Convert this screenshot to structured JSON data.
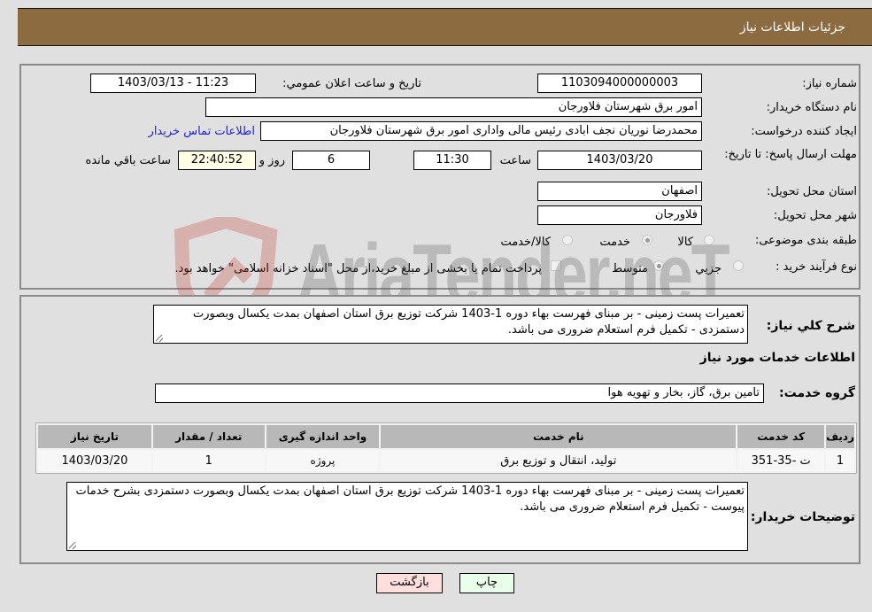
{
  "header": {
    "title": "جزئیات اطلاعات نیاز"
  },
  "form": {
    "need_number": {
      "label": "شماره نیاز:",
      "value": "1103094000000003"
    },
    "announce_datetime": {
      "label": "تاریخ و ساعت اعلان عمومي:",
      "value": "1403/03/13 - 11:23"
    },
    "buyer_org": {
      "label": "نام دستگاه خریدار:",
      "value": "امور برق شهرستان فلاورجان"
    },
    "requester": {
      "label": "ایجاد کننده درخواست:",
      "value": "محمدرضا نوریان نجف ابادی رئیس مالی واداری  امور برق شهرستان فلاورجان"
    },
    "buyer_contact_link": "اطلاعات تماس خریدار",
    "deadline": {
      "label": "مهلت ارسال پاسخ: تا تاریخ:",
      "date": "1403/03/20",
      "time_label": "ساعت",
      "time": "11:30",
      "days": "6",
      "days_label": "روز و",
      "remaining": "22:40:52",
      "remaining_label": "ساعت باقي مانده"
    },
    "province": {
      "label": "استان محل تحویل:",
      "value": "اصفهان"
    },
    "city": {
      "label": "شهر محل تحویل:",
      "value": "فلاورجان"
    },
    "category": {
      "label": "طبقه بندی موضوعی:",
      "options": [
        {
          "label": "کالا",
          "selected": false
        },
        {
          "label": "خدمت",
          "selected": true
        },
        {
          "label": "کالا/خدمت",
          "selected": false
        }
      ]
    },
    "purchase_type": {
      "label": "نوع فرآیند خرید :",
      "options": [
        {
          "label": "جزيي",
          "selected": false
        },
        {
          "label": "متوسط",
          "selected": true
        }
      ],
      "treasury_note": "پرداخت تمام یا بخشی از مبلغ خرید،از محل \"اسناد خزانه اسلامی\" خواهد بود.",
      "treasury_checked": false
    }
  },
  "description": {
    "label": "شرح كلي نياز:",
    "value": "تعمیرات پست زمینی  - بر مبنای فهرست بهاء دوره 1-1403 شرکت توزیع برق استان اصفهان بمدت یکسال وبصورت دستمزدی - تکمیل فرم استعلام ضروری می باشد."
  },
  "services": {
    "section_title": "اطلاعات خدمات مورد نیاز",
    "group_label": "گروه خدمت:",
    "group_value": "تامین برق، گاز، بخار و تهویه هوا",
    "table": {
      "headers": [
        "ردیف",
        "کد خدمت",
        "نام خدمت",
        "واحد اندازه گیری",
        "تعداد / مقدار",
        "تاریخ نیاز"
      ],
      "rows": [
        [
          "1",
          "ت -35-351",
          "تولید، انتقال و توزیع برق",
          "پروژه",
          "1",
          "1403/03/20"
        ]
      ]
    }
  },
  "buyer_notes": {
    "label": "توضیحات خریدار:",
    "value": "تعمیرات پست زمینی  - بر مبنای فهرست بهاء دوره 1-1403 شرکت توزیع برق استان اصفهان بمدت یکسال وبصورت دستمزدی بشرح خدمات پیوست - تکمیل فرم استعلام ضروری می باشد."
  },
  "buttons": {
    "print": "چاپ",
    "back": "بازگشت"
  },
  "watermark": {
    "text": "AriaTender.neT"
  },
  "colors": {
    "header": "#8c6b41",
    "print_btn": "#eaffea",
    "back_btn": "#ffdede",
    "link": "#2222cc"
  }
}
